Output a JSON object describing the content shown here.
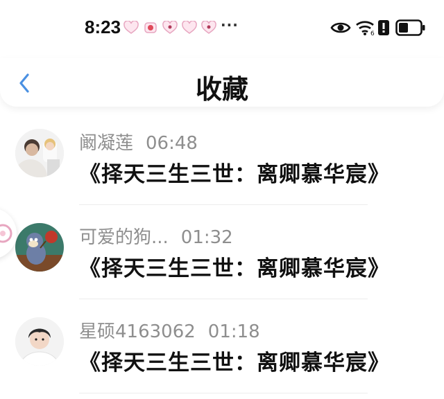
{
  "status_bar": {
    "time": "8:23",
    "notification_icons": [
      "heart-badge-icon",
      "heart-badge-icon",
      "heart-badge-icon",
      "heart-badge-icon",
      "heart-badge-icon"
    ],
    "more": "···",
    "system_icons": [
      "eye-icon",
      "wifi-icon",
      "alert-icon",
      "battery-icon"
    ]
  },
  "header": {
    "title": "收藏",
    "back_icon": "chevron-left-icon",
    "accent": "#4a90e2"
  },
  "favorites": [
    {
      "user": "阚凝莲",
      "time": "06:48",
      "content": "《择天三生三世：离卿慕华宸》",
      "avatar": "photo"
    },
    {
      "user": "可爱的狗...",
      "time": "01:32",
      "content": "《择天三生三世：离卿慕华宸》",
      "avatar": "cartoon"
    },
    {
      "user": "星硕4163062",
      "time": "01:18",
      "content": "《择天三生三世：离卿慕华宸》",
      "avatar": "portrait"
    }
  ]
}
